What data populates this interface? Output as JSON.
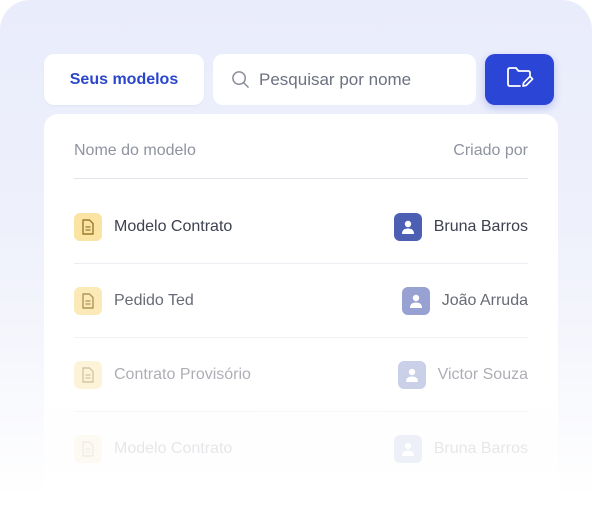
{
  "toolbar": {
    "tab_label": "Seus modelos",
    "search_placeholder": "Pesquisar por nome",
    "icons": {
      "search": "search-icon",
      "folder": "folder-edit-icon"
    },
    "accent_color": "#2b45d6"
  },
  "table": {
    "columns": [
      "Nome do modelo",
      "Criado por"
    ],
    "rows": [
      {
        "name": "Modelo Contrato",
        "owner": "Bruna  Barros"
      },
      {
        "name": "Pedido Ted",
        "owner": "João Arruda"
      },
      {
        "name": "Contrato Provisório",
        "owner": "Victor Souza"
      },
      {
        "name": "Modelo Contrato",
        "owner": "Bruna  Barros"
      }
    ],
    "icons": {
      "row": "document-icon",
      "owner": "user-avatar-icon"
    },
    "row_icon_color": "#fbe3a3",
    "avatar_color": "#4d5fb3"
  }
}
